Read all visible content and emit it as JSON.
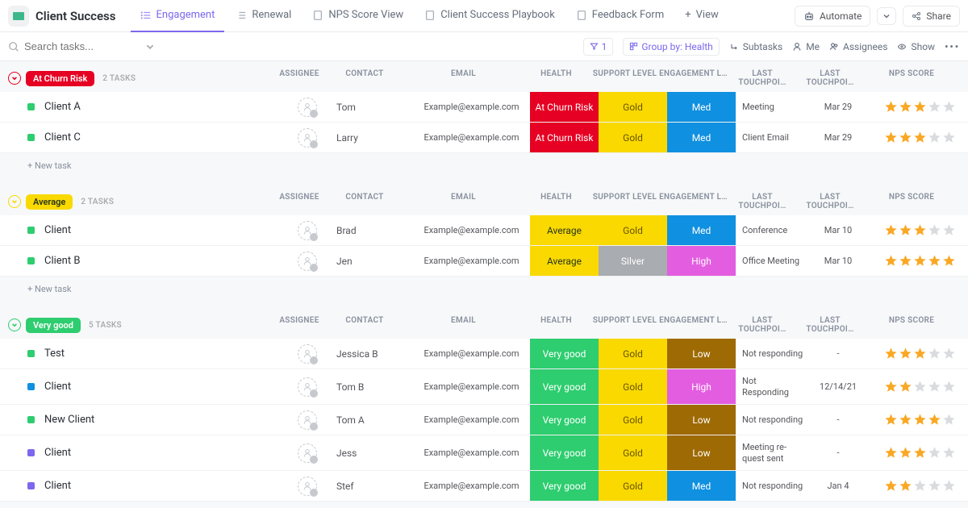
{
  "header": {
    "title": "Client Success",
    "tabs": [
      {
        "label": "Engagement",
        "active": true
      },
      {
        "label": "Renewal"
      },
      {
        "label": "NPS Score View"
      },
      {
        "label": "Client Success Playbook"
      },
      {
        "label": "Feedback Form"
      }
    ],
    "add_view": "View",
    "automate": "Automate",
    "share": "Share"
  },
  "toolbar": {
    "search_placeholder": "Search tasks...",
    "filter_count": "1",
    "group_by": "Group by: Health",
    "subtasks": "Subtasks",
    "me": "Me",
    "assignees": "Assignees",
    "show": "Show"
  },
  "columns": {
    "assignee": "ASSIGNEE",
    "contact": "CONTACT",
    "email": "EMAIL",
    "health": "HEALTH",
    "support": "SUPPORT LEVEL",
    "engage": "ENGAGEMENT L…",
    "touch1": "LAST TOUCHPOI…",
    "touch2": "LAST TOUCHPOI…",
    "nps": "NPS SCORE"
  },
  "new_task": "+ New task",
  "groups": [
    {
      "name": "At Churn Risk",
      "badge_class": "bg-churn",
      "caret_class": "caret-red",
      "count": "2 TASKS",
      "rows": [
        {
          "dot": "dot-green",
          "name": "Client A",
          "contact": "Tom",
          "email": "Example@example.com",
          "health": "At Churn Risk",
          "health_bg": "bg-churn",
          "support": "Gold",
          "support_bg": "bg-gold",
          "engage": "Med",
          "engage_bg": "bg-med",
          "touch1": "Meeting",
          "touch2": "Mar 29",
          "nps": 3
        },
        {
          "dot": "dot-green",
          "name": "Client C",
          "contact": "Larry",
          "email": "Example@example.com",
          "health": "At Churn Risk",
          "health_bg": "bg-churn",
          "support": "Gold",
          "support_bg": "bg-gold",
          "engage": "Med",
          "engage_bg": "bg-med",
          "touch1": "Client Email",
          "touch2": "Mar 29",
          "nps": 3
        }
      ]
    },
    {
      "name": "Average",
      "badge_class": "bg-average",
      "caret_class": "caret-yellow",
      "count": "2 TASKS",
      "rows": [
        {
          "dot": "dot-green",
          "name": "Client",
          "contact": "Brad",
          "email": "Example@example.com",
          "health": "Average",
          "health_bg": "bg-average",
          "support": "Gold",
          "support_bg": "bg-gold",
          "engage": "Med",
          "engage_bg": "bg-med",
          "touch1": "Conference",
          "touch2": "Mar 10",
          "nps": 3
        },
        {
          "dot": "dot-green",
          "name": "Client B",
          "contact": "Jen",
          "email": "Example@example.com",
          "health": "Average",
          "health_bg": "bg-average",
          "support": "Silver",
          "support_bg": "bg-silver",
          "engage": "High",
          "engage_bg": "bg-high",
          "touch1": "Office Meeting",
          "touch2": "Mar 10",
          "nps": 5
        }
      ]
    },
    {
      "name": "Very good",
      "badge_class": "bg-verygood",
      "caret_class": "caret-green",
      "count": "5 TASKS",
      "rows": [
        {
          "dot": "dot-green",
          "name": "Test",
          "contact": "Jessica B",
          "email": "Example@example.com",
          "health": "Very good",
          "health_bg": "bg-verygood",
          "support": "Gold",
          "support_bg": "bg-gold",
          "engage": "Low",
          "engage_bg": "bg-low",
          "touch1": "Not responding",
          "touch2": "-",
          "nps": 3
        },
        {
          "dot": "dot-blue",
          "name": "Client",
          "contact": "Tom B",
          "email": "Example@example.com",
          "health": "Very good",
          "health_bg": "bg-verygood",
          "support": "Gold",
          "support_bg": "bg-gold",
          "engage": "High",
          "engage_bg": "bg-high",
          "touch1": "Not Responding",
          "touch2": "12/14/21",
          "nps": 2,
          "tall": true
        },
        {
          "dot": "dot-green",
          "name": "New Client",
          "contact": "Tom A",
          "email": "Example@example.com",
          "health": "Very good",
          "health_bg": "bg-verygood",
          "support": "Gold",
          "support_bg": "bg-gold",
          "engage": "Low",
          "engage_bg": "bg-low",
          "touch1": "Not responding",
          "touch2": "-",
          "nps": 4
        },
        {
          "dot": "dot-purple",
          "name": "Client",
          "contact": "Jess",
          "email": "Example@example.com",
          "health": "Very good",
          "health_bg": "bg-verygood",
          "support": "Gold",
          "support_bg": "bg-gold",
          "engage": "Low",
          "engage_bg": "bg-low",
          "touch1": "Meeting re-quest sent",
          "touch2": "-",
          "nps": 3,
          "tall": true
        },
        {
          "dot": "dot-purple",
          "name": "Client",
          "contact": "Stef",
          "email": "Example@example.com",
          "health": "Very good",
          "health_bg": "bg-verygood",
          "support": "Gold",
          "support_bg": "bg-gold",
          "engage": "Med",
          "engage_bg": "bg-med",
          "touch1": "Not responding",
          "touch2": "Jan 4",
          "nps": 2
        }
      ]
    }
  ]
}
